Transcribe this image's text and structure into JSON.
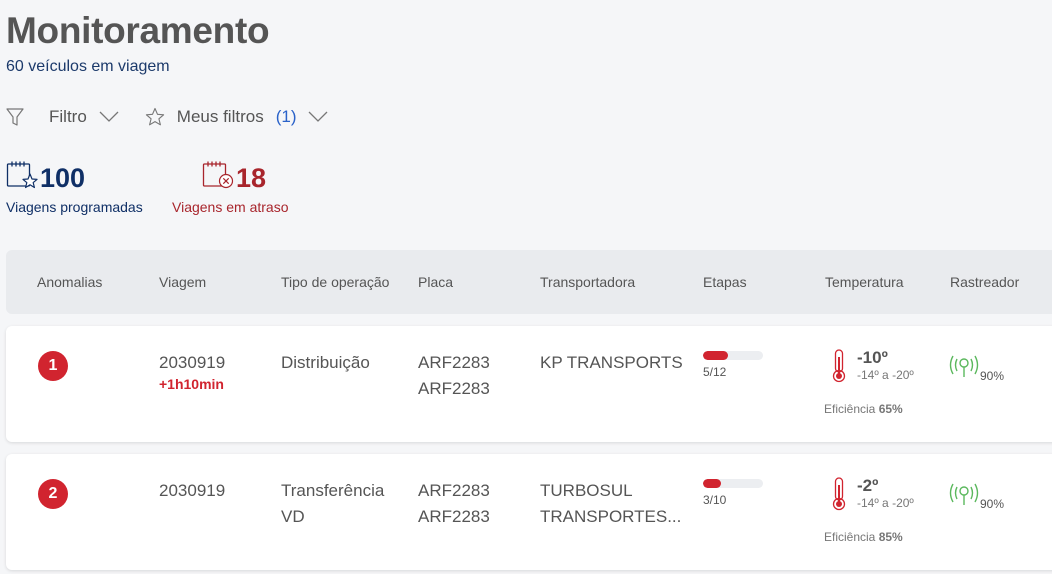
{
  "header": {
    "title": "Monitoramento",
    "subtitle": "60 veículos em viagem"
  },
  "filters": {
    "filter_label": "Filtro",
    "my_filters_label": "Meus filtros",
    "my_filters_count": "(1)"
  },
  "stats": {
    "scheduled": {
      "value": "100",
      "label": "Viagens programadas",
      "color": "#0f2f66"
    },
    "delayed": {
      "value": "18",
      "label": "Viagens em atraso",
      "color": "#a8252c"
    }
  },
  "table": {
    "columns": [
      "Anomalias",
      "Viagem",
      "Tipo de operação",
      "Placa",
      "Transportadora",
      "Etapas",
      "Temperatura",
      "Rastreador"
    ],
    "rows": [
      {
        "anomaly": "1",
        "trip": "2030919",
        "delay": "+1h10min",
        "operation": "Distribuição",
        "operation2": "",
        "plate1": "ARF2283",
        "plate2": "ARF2283",
        "carrier1": "KP TRANSPORTS",
        "carrier2": "",
        "steps": "5/12",
        "steps_progress": 0.417,
        "temperature": "-10º",
        "temp_range": "-14º a -20º",
        "efficiency_label": "Eficiência",
        "efficiency": "65%",
        "tracker": "90%"
      },
      {
        "anomaly": "2",
        "trip": "2030919",
        "delay": "",
        "operation": "Transferência",
        "operation2": "VD",
        "plate1": "ARF2283",
        "plate2": "ARF2283",
        "carrier1": "TURBOSUL",
        "carrier2": "TRANSPORTES...",
        "steps": "3/10",
        "steps_progress": 0.3,
        "temperature": "-2º",
        "temp_range": "-14º a -20º",
        "efficiency_label": "Eficiência",
        "efficiency": "85%",
        "tracker": "90%"
      }
    ]
  },
  "colors": {
    "accent_red": "#d1242f",
    "accent_blue": "#2a62c9",
    "tracker_green": "#5bb85d"
  }
}
